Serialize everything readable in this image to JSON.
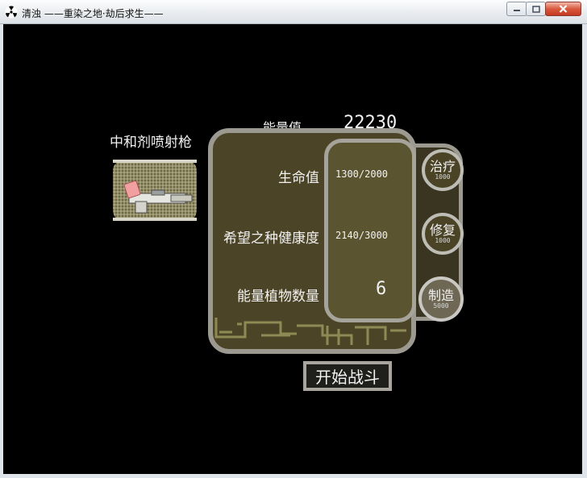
{
  "window": {
    "title": "清浊 ——重染之地·劫后求生——",
    "icon": "radiation-icon",
    "controls": [
      "minimize-icon",
      "maximize-icon",
      "close-icon"
    ]
  },
  "weapon": {
    "name": "中和剂喷射枪",
    "icon": "spray-gun-icon"
  },
  "energy": {
    "label": "能量值",
    "value": "22230"
  },
  "stats": {
    "life": {
      "label": "生命值",
      "value": "1300/2000"
    },
    "hope": {
      "label": "希望之种健康度",
      "value": "2140/3000"
    },
    "plants": {
      "label": "能量植物数量",
      "value": "6"
    }
  },
  "actions": {
    "heal": {
      "label": "治疗",
      "cost": "1000"
    },
    "repair": {
      "label": "修复",
      "cost": "1000"
    },
    "make": {
      "label": "制造",
      "cost": "5000"
    }
  },
  "start_button": "开始战斗",
  "colors": {
    "background": "#000000",
    "panel": "#4b4426",
    "panel_border": "#9b9990",
    "text": "#f2f2f2"
  }
}
